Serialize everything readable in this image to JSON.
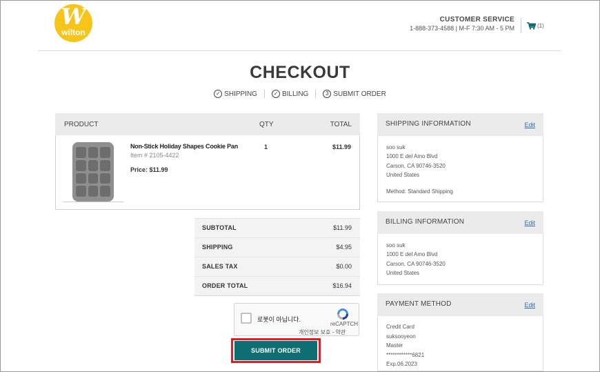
{
  "brand": {
    "logo_letter": "W",
    "logo_text": "wilton"
  },
  "header": {
    "customer_service_title": "CUSTOMER SERVICE",
    "customer_service_phone": "1-888-373-4588 | M-F 7:30 AM - 5 PM",
    "cart_count": "(1)"
  },
  "page_title": "CHECKOUT",
  "steps": [
    {
      "label": "SHIPPING",
      "marker": "✓"
    },
    {
      "label": "BILLING",
      "marker": "✓"
    },
    {
      "label": "SUBMIT ORDER",
      "marker": "3"
    }
  ],
  "product_table": {
    "headers": {
      "product": "PRODUCT",
      "qty": "QTY",
      "total": "TOTAL"
    },
    "items": [
      {
        "name": "Non-Stick Holiday Shapes Cookie Pan",
        "item_number": "Item # 2105-4422",
        "price_label": "Price: $11.99",
        "qty": "1",
        "total": "$11.99"
      }
    ]
  },
  "summary": [
    {
      "label": "SUBTOTAL",
      "value": "$11.99"
    },
    {
      "label": "SHIPPING",
      "value": "$4.95"
    },
    {
      "label": "SALES TAX",
      "value": "$0.00"
    },
    {
      "label": "ORDER TOTAL",
      "value": "$16.94"
    }
  ],
  "captcha": {
    "label": "로봇이 아닙니다.",
    "brand": "reCAPTCH",
    "privacy": "개인정보 보호 - 약관"
  },
  "submit_label": "SUBMIT ORDER",
  "shipping_info": {
    "title": "SHIPPING INFORMATION",
    "edit_label": "Edit",
    "lines": [
      "soo suk",
      "1000 E del Amo Blvd",
      "Carson, CA 90746-3520",
      "United States"
    ],
    "method": "Method: Standard Shipping"
  },
  "billing_info": {
    "title": "BILLING INFORMATION",
    "edit_label": "Edit",
    "lines": [
      "soo suk",
      "1000 E del Amo Blvd",
      "Carson, CA 90746-3520",
      "United States"
    ]
  },
  "payment_method": {
    "title": "PAYMENT METHOD",
    "edit_label": "Edit",
    "lines": [
      "Credit Card",
      "suksooyeon",
      "Master",
      "************6821",
      "Exp.06.2023"
    ]
  },
  "colors": {
    "submit_bg": "#0f6e71",
    "highlight_border": "#e01b24",
    "logo_yellow": "#f7c519",
    "link_blue": "#2a6db5",
    "cart_teal": "#0f6e71"
  }
}
